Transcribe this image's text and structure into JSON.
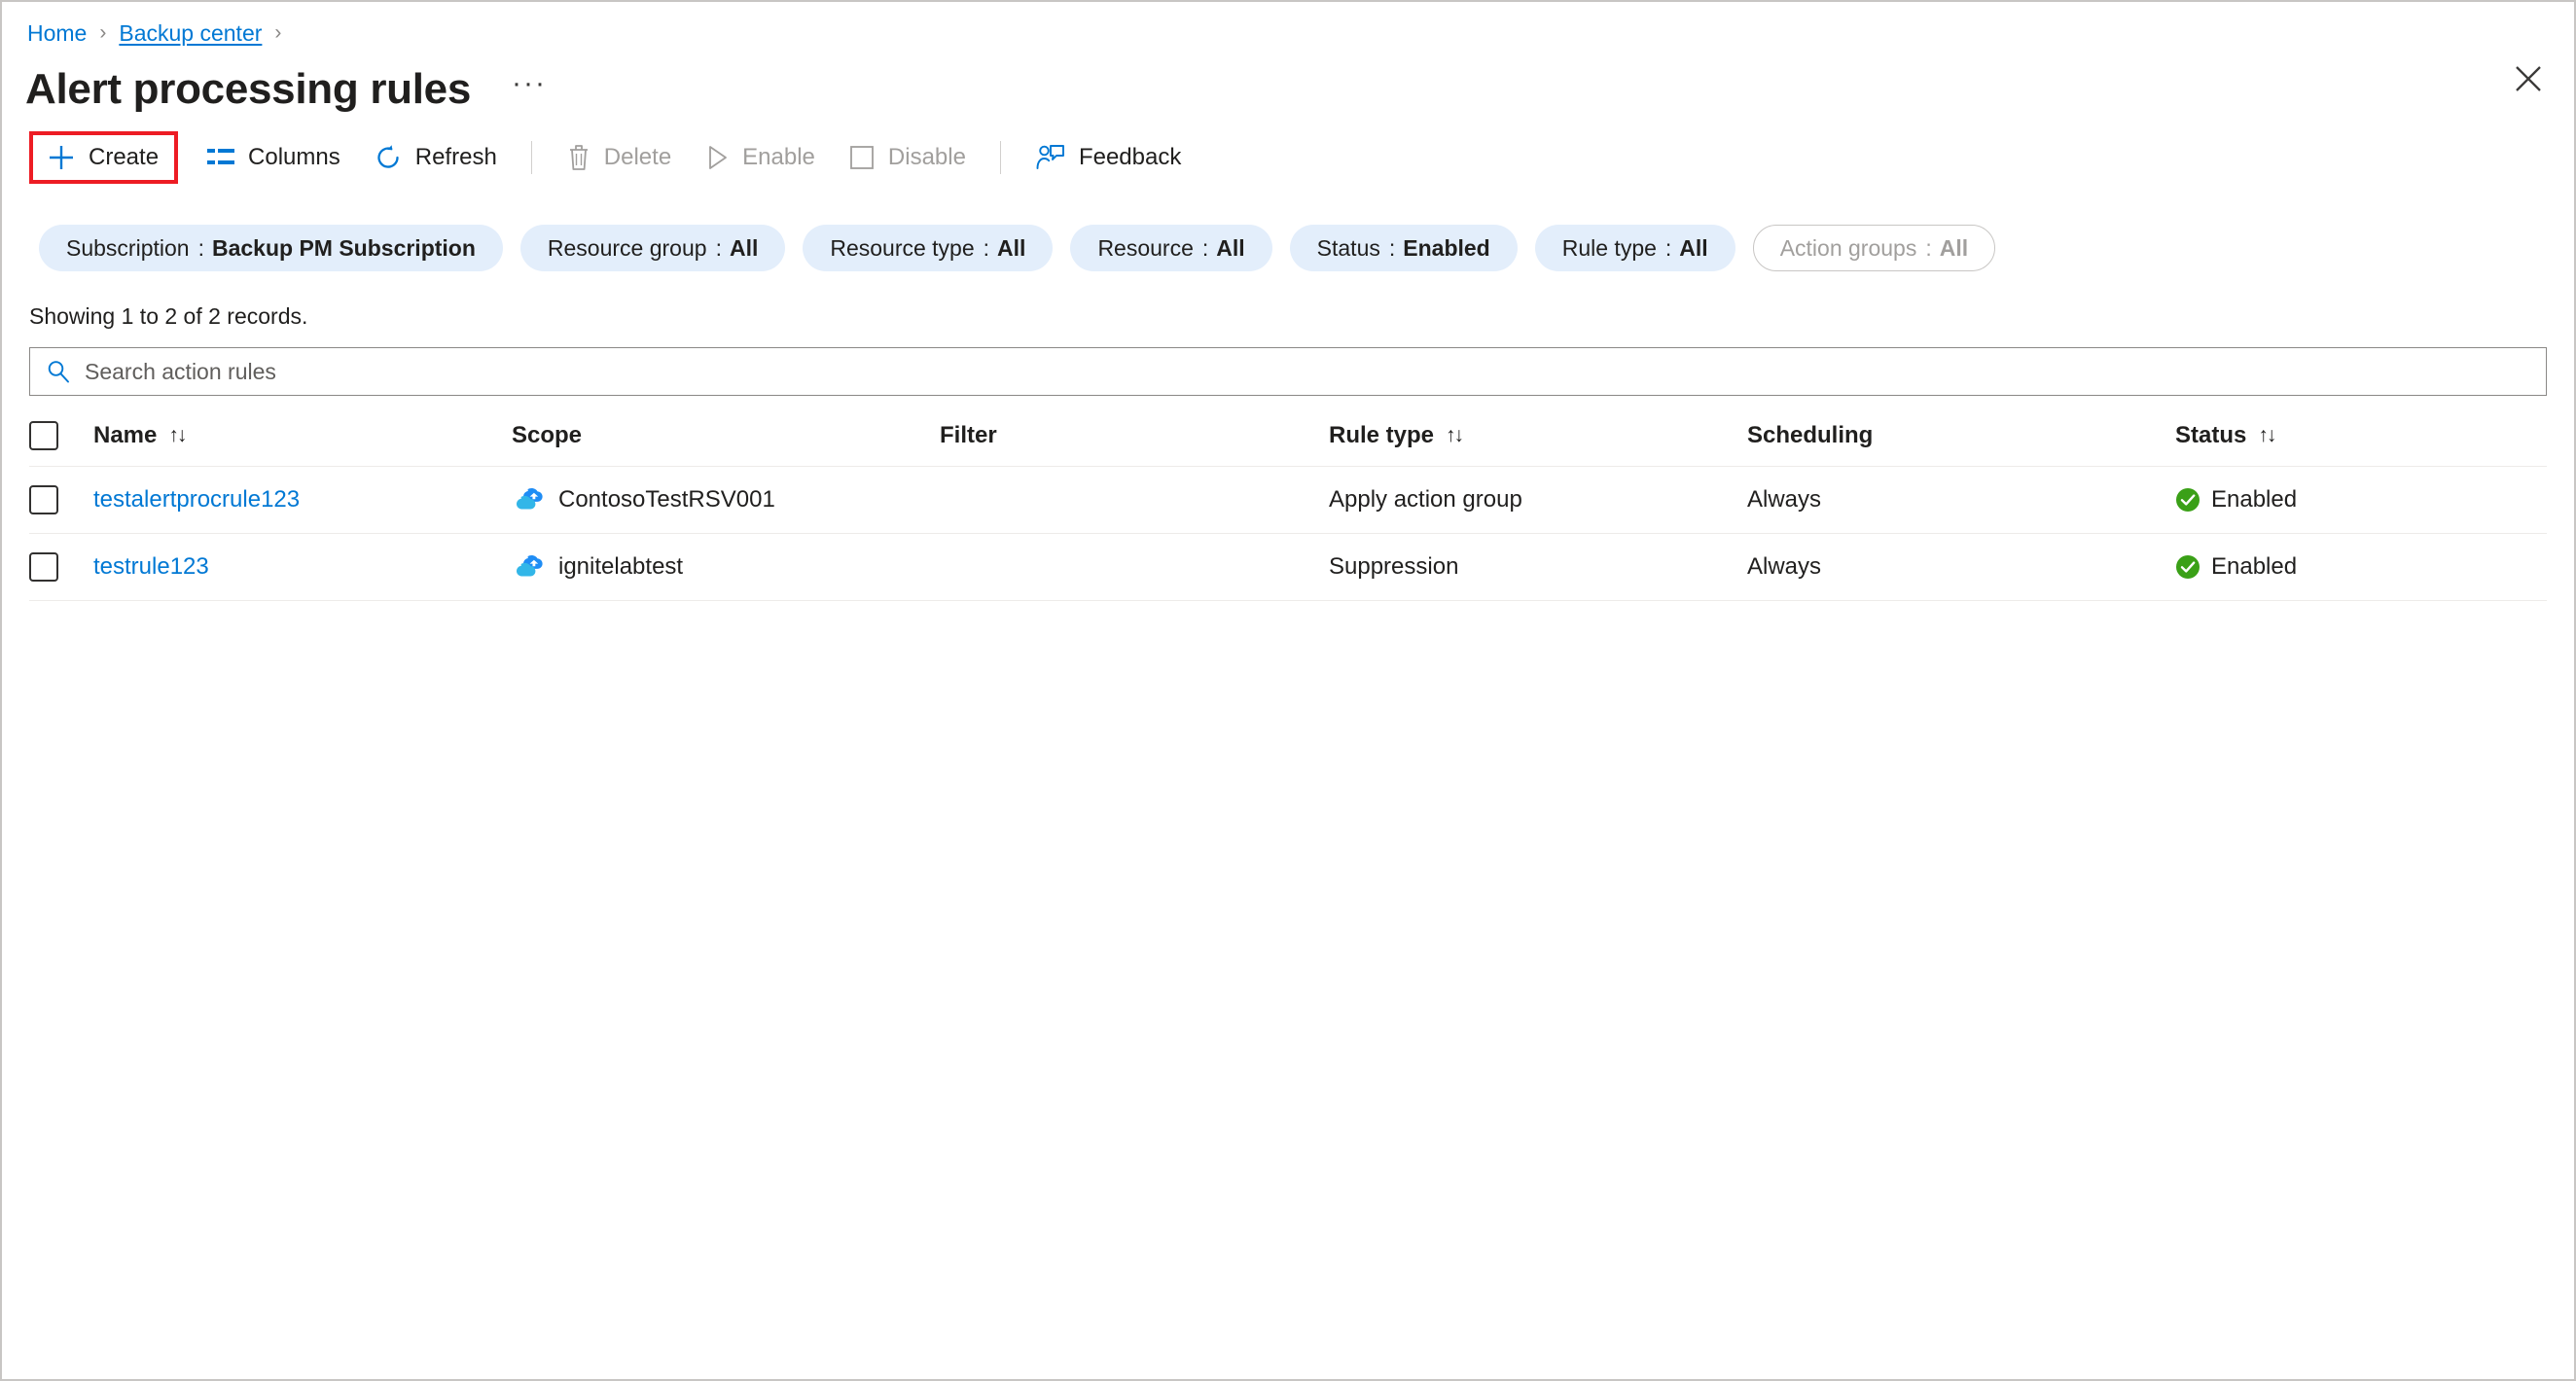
{
  "breadcrumb": {
    "items": [
      {
        "label": "Home",
        "underlined": false
      },
      {
        "label": "Backup center",
        "underlined": true
      }
    ],
    "separator": "›"
  },
  "header": {
    "title": "Alert processing rules",
    "ellipsis": "···",
    "close_icon": "close-icon"
  },
  "toolbar": {
    "items": [
      {
        "label": "Create",
        "icon": "plus-icon",
        "disabled": false,
        "highlighted": true
      },
      {
        "label": "Columns",
        "icon": "columns-icon",
        "disabled": false,
        "highlighted": false
      },
      {
        "label": "Refresh",
        "icon": "refresh-icon",
        "disabled": false,
        "highlighted": false
      },
      {
        "label": "Delete",
        "icon": "trash-icon",
        "disabled": true,
        "highlighted": false
      },
      {
        "label": "Enable",
        "icon": "play-icon",
        "disabled": true,
        "highlighted": false
      },
      {
        "label": "Disable",
        "icon": "square-icon",
        "disabled": true,
        "highlighted": false
      },
      {
        "label": "Feedback",
        "icon": "feedback-icon",
        "disabled": false,
        "highlighted": false
      }
    ],
    "highlight_color": "#ed1c24"
  },
  "filters": [
    {
      "label": "Subscription",
      "value": "Backup PM Subscription",
      "disabled": false
    },
    {
      "label": "Resource group",
      "value": "All",
      "disabled": false
    },
    {
      "label": "Resource type",
      "value": "All",
      "disabled": false
    },
    {
      "label": "Resource",
      "value": "All",
      "disabled": false
    },
    {
      "label": "Status",
      "value": "Enabled",
      "disabled": false
    },
    {
      "label": "Rule type",
      "value": "All",
      "disabled": false
    },
    {
      "label": "Action groups",
      "value": "All",
      "disabled": true
    }
  ],
  "records_text": "Showing 1 to 2 of 2 records.",
  "search": {
    "placeholder": "Search action rules",
    "value": "",
    "icon": "search-icon"
  },
  "table": {
    "columns": [
      {
        "label": "Name",
        "sortable": true
      },
      {
        "label": "Scope",
        "sortable": false
      },
      {
        "label": "Filter",
        "sortable": false
      },
      {
        "label": "Rule type",
        "sortable": true
      },
      {
        "label": "Scheduling",
        "sortable": false
      },
      {
        "label": "Status",
        "sortable": true
      }
    ],
    "sort_glyph": "↑↓",
    "rows": [
      {
        "name": "testalertprocrule123",
        "scope": "ContosoTestRSV001",
        "scope_icon": "recovery-services-vault-icon",
        "filter": "",
        "rule_type": "Apply action group",
        "scheduling": "Always",
        "status": "Enabled",
        "status_icon": "check-circle-icon"
      },
      {
        "name": "testrule123",
        "scope": "ignitelabtest",
        "scope_icon": "recovery-services-vault-icon",
        "filter": "",
        "rule_type": "Suppression",
        "scheduling": "Always",
        "status": "Enabled",
        "status_icon": "check-circle-icon"
      }
    ]
  },
  "colors": {
    "link": "#0078d4",
    "pill_bg": "#e3eefb",
    "status_ok": "#3aa017",
    "highlight": "#ed1c24"
  }
}
